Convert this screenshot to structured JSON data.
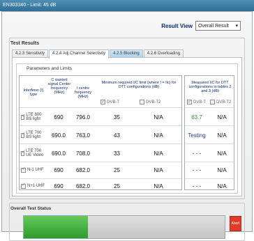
{
  "window": {
    "title": "EN303340 - Limit: 45 dB"
  },
  "result_view": {
    "label": "Result View",
    "selected": "Overall Result",
    "options": [
      "Overall Result"
    ]
  },
  "test_results": {
    "title": "Test Results"
  },
  "tabs": [
    {
      "label": "4.2.3 Sensitivity",
      "active": false
    },
    {
      "label": "4.2.4 Adj Channel Selectivity",
      "active": true
    },
    {
      "label": "4.2.5 Blocking",
      "active": false
    },
    {
      "label": "4.2.6 Overloading",
      "active": false
    }
  ],
  "params": {
    "title": "Parameters and Limits",
    "headers": {
      "interferer": "Interferer (I) type",
      "wanted": "C wanted signal Center frequency (MHz)",
      "centre": "I centre frequency (MHz)",
      "min_required": "Minimum required I/C limit (where I = Ilc) for DTT configurations (dB)",
      "measured": "Measured I/C for DTT configurations in tables 2 and 3 (dB)"
    },
    "dvbt_label": "DVB-T",
    "dvbt2_label": "DVB-T2",
    "rows": [
      {
        "interferer": "LTE 800 BS light",
        "wanted": "690",
        "centre": "796.0",
        "min_dvbt": "35",
        "min_dvbt2": "N/A",
        "meas_dvbt": "63.7",
        "meas_dvbt2": "N/A",
        "meas_dvbt_color": "#2e9c2e"
      },
      {
        "interferer": "LTE 700 BS light",
        "wanted": "690.0",
        "centre": "763.0",
        "min_dvbt": "43",
        "min_dvbt2": "N/A",
        "meas_dvbt": "Testing",
        "meas_dvbt2": "N/A",
        "meas_dvbt_color": "#1f3b8f"
      },
      {
        "interferer": "LTE 700 UE Video",
        "wanted": "690.0",
        "centre": "708.0",
        "min_dvbt": "33",
        "min_dvbt2": "N/A",
        "meas_dvbt": "- - -",
        "meas_dvbt2": "N/A",
        "meas_dvbt_color": "#111111"
      },
      {
        "interferer": "N-1 UHF",
        "wanted": "690",
        "centre": "682.0",
        "min_dvbt": "25",
        "min_dvbt2": "N/A",
        "meas_dvbt": "- - -",
        "meas_dvbt2": "N/A",
        "meas_dvbt_color": "#111111"
      },
      {
        "interferer": "N+1 UHF",
        "wanted": "690",
        "centre": "682.0",
        "min_dvbt": "25",
        "min_dvbt2": "N/A",
        "meas_dvbt": "- - -",
        "meas_dvbt2": "N/A",
        "meas_dvbt_color": "#111111"
      }
    ]
  },
  "overall_status": {
    "title": "Overall Test Status",
    "progress": 0.32,
    "abort_label": "Abort"
  }
}
